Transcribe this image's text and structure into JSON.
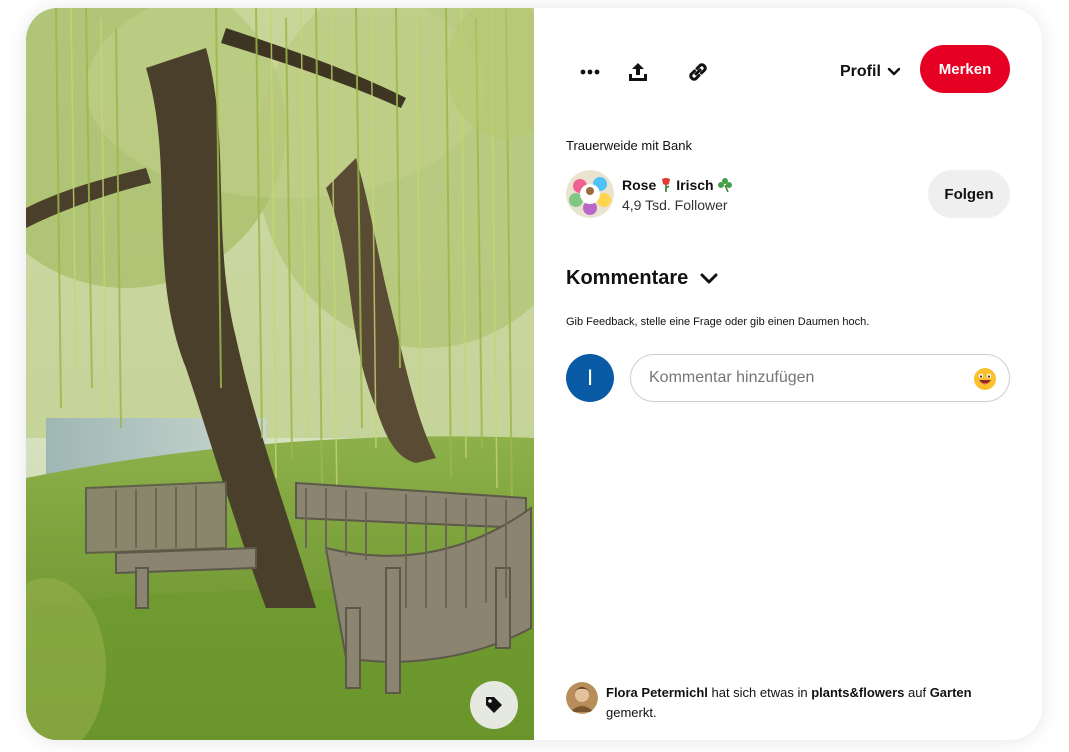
{
  "pin": {
    "title": "Trauerweide mit Bank"
  },
  "toolbar": {
    "more_icon": "more-dots-icon",
    "share_icon": "share-upload-icon",
    "link_icon": "link-chain-icon",
    "profile_label": "Profil",
    "save_label": "Merken"
  },
  "author": {
    "name_first": "Rose",
    "name_last": "Irisch",
    "followers": "4,9 Tsd. Follower",
    "follow_label": "Folgen"
  },
  "comments": {
    "title": "Kommentare",
    "hint": "Gib Feedback, stelle eine Frage oder gib einen Daumen hoch.",
    "user_initial": "I",
    "placeholder": "Kommentar hinzufügen"
  },
  "activity": {
    "user": "Flora Petermichl",
    "text1": " hat sich etwas in ",
    "board": "plants&flowers",
    "text2": " auf ",
    "profile": "Garten",
    "text3": " gemerkt."
  },
  "colors": {
    "save_button": "#e60023",
    "follow_button": "#efefef",
    "user_avatar": "#0a5ba6"
  }
}
